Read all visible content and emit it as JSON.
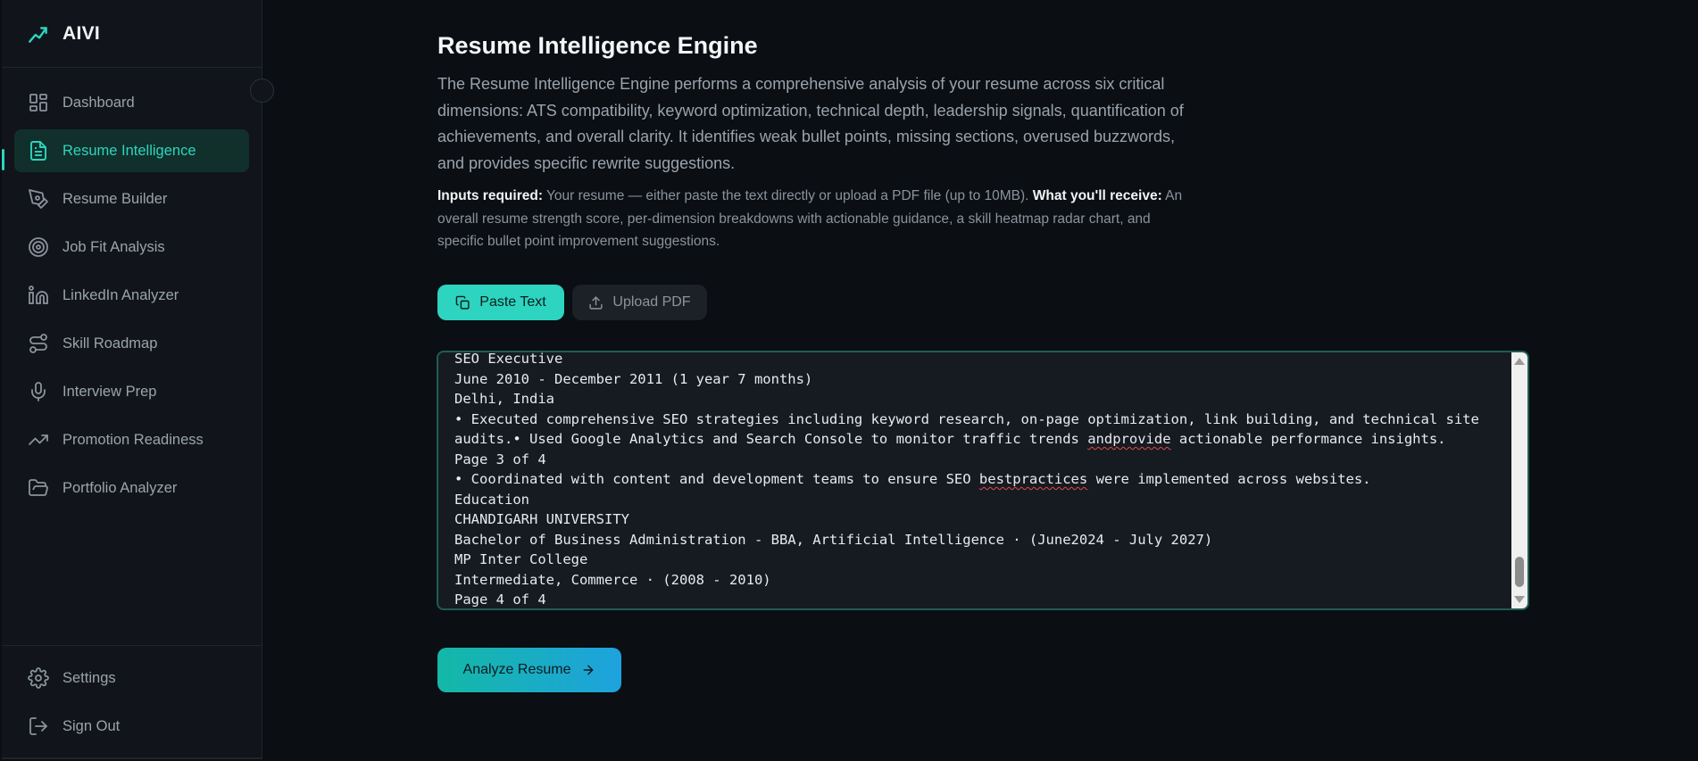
{
  "app": {
    "name": "AIVI",
    "accent_color": "#2dd4bf"
  },
  "sidebar": {
    "items": [
      {
        "label": "Dashboard",
        "icon": "dashboard-grid-icon"
      },
      {
        "label": "Resume Intelligence",
        "icon": "document-icon",
        "active": true
      },
      {
        "label": "Resume Builder",
        "icon": "pen-tool-icon"
      },
      {
        "label": "Job Fit Analysis",
        "icon": "target-icon"
      },
      {
        "label": "LinkedIn Analyzer",
        "icon": "linkedin-icon"
      },
      {
        "label": "Skill Roadmap",
        "icon": "route-icon"
      },
      {
        "label": "Interview Prep",
        "icon": "microphone-icon"
      },
      {
        "label": "Promotion Readiness",
        "icon": "trending-up-icon"
      },
      {
        "label": "Portfolio Analyzer",
        "icon": "folder-open-icon"
      }
    ],
    "footer": [
      {
        "label": "Settings",
        "icon": "gear-icon"
      },
      {
        "label": "Sign Out",
        "icon": "sign-out-icon"
      }
    ]
  },
  "main": {
    "title": "Resume Intelligence Engine",
    "intro": "The Resume Intelligence Engine performs a comprehensive analysis of your resume across six critical dimensions: ATS compatibility, keyword optimization, technical depth, leadership signals, quantification of achievements, and overall clarity. It identifies weak bullet points, missing sections, overused buzzwords, and provides specific rewrite suggestions.",
    "inputs_label": "Inputs required:",
    "inputs_text": " Your resume — either paste the text directly or upload a PDF file (up to 10MB). ",
    "receive_label": "What you'll receive:",
    "receive_text": " An overall resume strength score, per-dimension breakdowns with actionable guidance, a skill heatmap radar chart, and specific bullet point improvement suggestions.",
    "tabs": {
      "paste": "Paste Text",
      "upload": "Upload PDF",
      "active": "paste"
    },
    "resume_lines": [
      "SEO Executive",
      "June 2010 - December 2011 (1 year 7 months)",
      "Delhi, India",
      "• Executed comprehensive SEO strategies including keyword research, on-page optimization, link building, and technical site",
      "audits.• Used Google Analytics and Search Console to monitor traffic trends andprovide actionable performance insights.",
      "Page 3 of 4",
      "• Coordinated with content and development teams to ensure SEO bestpractices were implemented across websites.",
      "Education",
      "CHANDIGARH UNIVERSITY",
      "Bachelor of Business Administration - BBA, Artificial Intelligence · (June2024 - July 2027)",
      "MP Inter College",
      "Intermediate, Commerce · (2008 - 2010)",
      "Page 4 of 4"
    ],
    "spellcheck_words": [
      "andprovide",
      "bestpractices"
    ],
    "analyze_label": "Analyze Resume"
  }
}
